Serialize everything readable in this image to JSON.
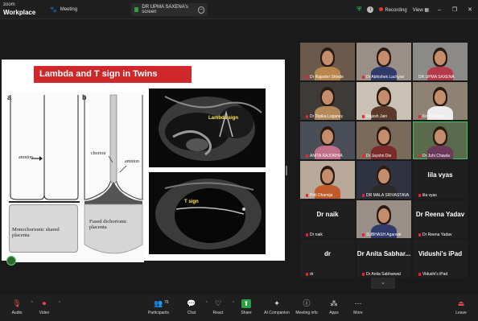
{
  "app": {
    "brand_line1": "zoom",
    "brand_line2": "Workplace"
  },
  "tabs": [
    {
      "label": "Meeting",
      "icon": "paw-icon"
    },
    {
      "label": "DR UPMA SAXENA's screen",
      "icon": "share-screen-icon"
    }
  ],
  "topbar": {
    "recording": "Recording",
    "view": "View",
    "min": "–",
    "max": "❐",
    "close": "✕"
  },
  "slide": {
    "title": "Lambda and T sign in Twins",
    "label_a": "a",
    "label_b": "b",
    "amnion_a": "amnion",
    "chorion": "chorion",
    "amnion_b": "amnion",
    "mono_placenta": "Monochorionic shared placenta",
    "fused_placenta": "Fused dichorionic placenta",
    "us_label_1": "Lambda sign",
    "us_label_2": "T sign"
  },
  "gallery": [
    {
      "name": "Dr Rajashri Shinde",
      "muted": true,
      "video": true
    },
    {
      "name": "Dr Abhishek Lachyan",
      "muted": true,
      "video": true
    },
    {
      "name": "DR UPMA SAXENA",
      "muted": false,
      "video": true
    },
    {
      "name": "Dr Dipika Loganey",
      "muted": true,
      "video": true
    },
    {
      "name": "Rajesh Jain",
      "muted": true,
      "video": true
    },
    {
      "name": "Kiran's iPad",
      "muted": true,
      "video": true
    },
    {
      "name": "ANITA RAJORHIA",
      "muted": true,
      "video": true
    },
    {
      "name": "Dr Jayshri Die",
      "muted": true,
      "video": true
    },
    {
      "name": "Dr Juhi Chawla",
      "muted": true,
      "video": true,
      "active": true
    },
    {
      "name": "Priti Dhamija",
      "muted": true,
      "video": true
    },
    {
      "name": "DR MALA SRIVASTAVA",
      "muted": true,
      "video": true
    },
    {
      "name": "lila vyas",
      "muted": true,
      "video": false,
      "big": "lila vyas"
    },
    {
      "name": "Dr naik",
      "muted": true,
      "video": false,
      "big": "Dr naik"
    },
    {
      "name": "SUBHASH Agarwal",
      "muted": true,
      "video": true
    },
    {
      "name": "Dr Reena Yadav",
      "muted": true,
      "video": false,
      "big": "Dr Reena Yadav"
    },
    {
      "name": "dr",
      "muted": true,
      "video": false,
      "big": "dr"
    },
    {
      "name": "Dr Anita Sabharwal",
      "muted": true,
      "video": false,
      "big": "Dr Anita Sabhar..."
    },
    {
      "name": "Vidushi's iPad",
      "muted": true,
      "video": false,
      "big": "Vidushi's iPad"
    }
  ],
  "toolbar": {
    "audio": "Audio",
    "video": "Video",
    "participants": "Participants",
    "participants_count": "76",
    "chat": "Chat",
    "react": "React",
    "share": "Share",
    "ai_companion": "AI Companion",
    "meeting_info": "Meeting info",
    "apps": "Apps",
    "more": "More",
    "leave": "Leave"
  },
  "colors": {
    "accent_green": "#2ea043",
    "title_red": "#d0272b",
    "mute_red": "#e5484d"
  }
}
